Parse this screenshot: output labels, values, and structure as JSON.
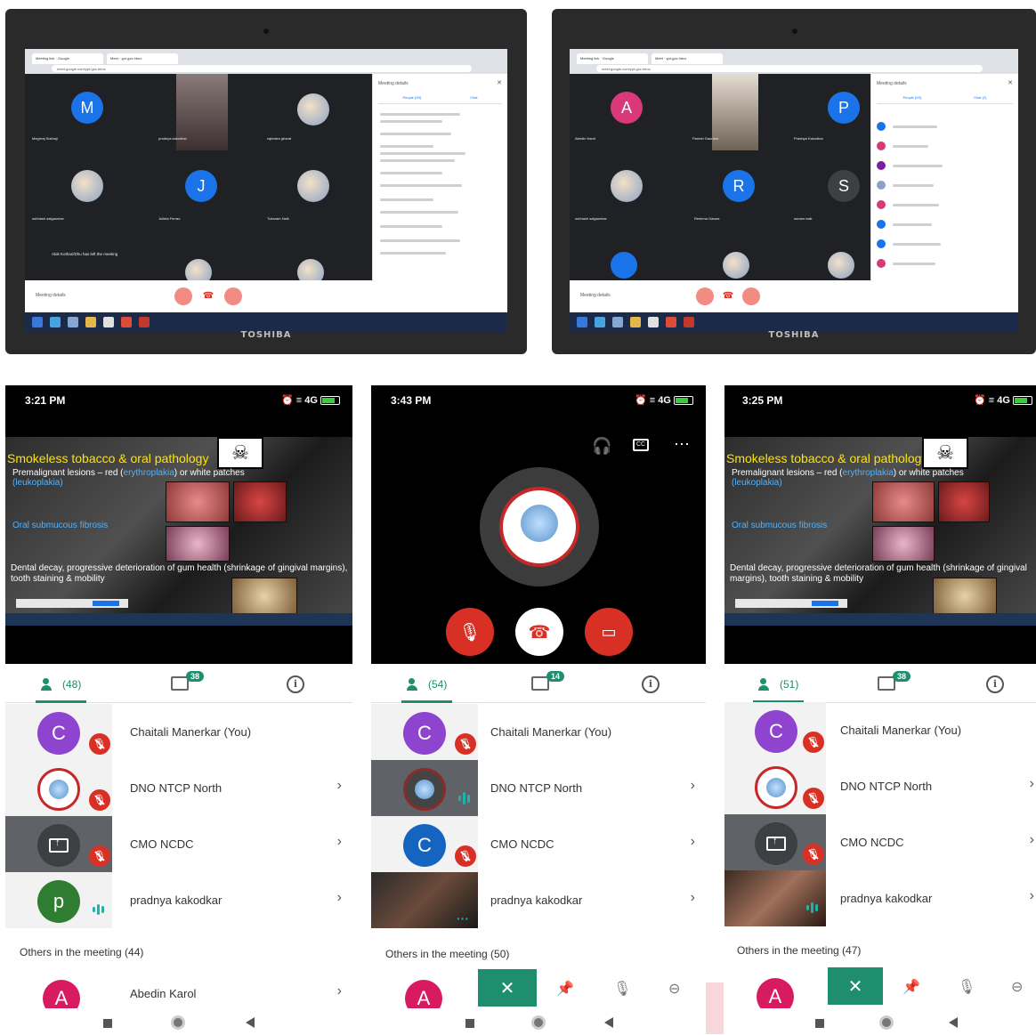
{
  "colors": {
    "meet_green": "#1e8e6e",
    "end_red": "#d93025",
    "slide_yellow": "#ffe400",
    "slide_blue": "#4fb3ff"
  },
  "laptops": [
    {
      "brand": "TOSHIBA",
      "meeting_details": "Meeting details",
      "panel_title": "Meeting details",
      "tabs": [
        "People (53)",
        "Chat"
      ],
      "tiles": [
        {
          "initial": "M",
          "name": "Meghraj Sukhaji",
          "color": "#1a73e8"
        },
        {
          "initial": "",
          "name": "pradnya kakodkar",
          "photo": true
        },
        {
          "initial": "",
          "name": "rajendra gharat",
          "photo": true
        },
        {
          "initial": "",
          "name": "subhash salgaonkar",
          "photo": true
        },
        {
          "initial": "J",
          "name": "Julieta Ferrao",
          "color": "#1a73e8"
        },
        {
          "initial": "",
          "name": "Tukaram Naik",
          "photo": true
        }
      ],
      "left_msg": "Alok Kothari/Dhu has left the meeting"
    },
    {
      "brand": "TOSHIBA",
      "meeting_details": "Meeting details",
      "panel_title": "Meeting details",
      "tabs": [
        "People (53)",
        "Chat (2)"
      ],
      "tiles": [
        {
          "initial": "A",
          "name": "Abedin Karol",
          "color": "#d93879"
        },
        {
          "initial": "",
          "name": "Paresh Gaonkar",
          "photo": true
        },
        {
          "initial": "P",
          "name": "Pradnya Kakodkar",
          "color": "#1a73e8"
        },
        {
          "initial": "",
          "name": "subhash salgaonkar",
          "photo": true
        },
        {
          "initial": "R",
          "name": "Reshma Gawas",
          "color": "#1a73e8"
        },
        {
          "initial": "S",
          "name": "sonam naik",
          "color": "#3c4043"
        }
      ]
    }
  ],
  "phones": [
    {
      "time": "3:21 PM",
      "network": "4G",
      "slide": {
        "title": "Smokeless tobacco & oral pathology",
        "line1": "Premalignant lesions – red (",
        "line1_hl": "erythroplakia",
        "line1_end": ") or white patches",
        "line2": "(leukoplakia)",
        "line3": "Oral submucous fibrosis",
        "line4": "Dental decay, progressive deterioration of gum health (shrinkage of gingival margins), tooth staining & mobility"
      },
      "people_count": "(48)",
      "chat_count": "38",
      "participants": [
        {
          "name": "Chaitali Manerkar (You)",
          "type": "avatar",
          "initial": "C",
          "color": "#8e44ce",
          "status": "muted"
        },
        {
          "name": "DNO NTCP North",
          "type": "logo",
          "status": "muted"
        },
        {
          "name": "CMO NCDC",
          "type": "screen",
          "status": "muted"
        },
        {
          "name": "pradnya kakodkar",
          "type": "avatar",
          "initial": "p",
          "color": "#2e7d32",
          "status": "speaking"
        }
      ],
      "others": "Others in the meeting (44)",
      "next": {
        "name": "Abedin Karol",
        "initial": "A",
        "color": "#d81b60"
      }
    },
    {
      "time": "3:43 PM",
      "network": "4G",
      "people_count": "(54)",
      "chat_count": "14",
      "participants": [
        {
          "name": "Chaitali Manerkar (You)",
          "type": "avatar",
          "initial": "C",
          "color": "#8e44ce",
          "status": "muted"
        },
        {
          "name": "DNO NTCP North",
          "type": "logo-dark",
          "status": "speaking"
        },
        {
          "name": "CMO NCDC",
          "type": "avatar",
          "initial": "C",
          "color": "#1565c0",
          "status": "muted"
        },
        {
          "name": "pradnya kakodkar",
          "type": "photo",
          "status": "dots"
        }
      ],
      "others": "Others in the meeting (50)",
      "next": {
        "name": "",
        "initial": "A",
        "color": "#d81b60"
      }
    },
    {
      "time": "3:25 PM",
      "network": "4G",
      "slide": {
        "title": "Smokeless tobacco & oral pathology",
        "line1": "Premalignant lesions – red (",
        "line1_hl": "erythroplakia",
        "line1_end": ") or white patches",
        "line2": "(leukoplakia)",
        "line3": "Oral submucous fibrosis",
        "line4": "Dental decay, progressive deterioration of gum health (shrinkage of gingival margins), tooth staining & mobility"
      },
      "people_count": "(51)",
      "chat_count": "38",
      "participants": [
        {
          "name": "Chaitali Manerkar (You)",
          "type": "avatar",
          "initial": "C",
          "color": "#8e44ce",
          "status": "muted"
        },
        {
          "name": "DNO NTCP North",
          "type": "logo",
          "status": "muted"
        },
        {
          "name": "CMO NCDC",
          "type": "screen",
          "status": "muted"
        },
        {
          "name": "pradnya kakodkar",
          "type": "photo",
          "status": "speaking"
        }
      ],
      "others": "Others in the meeting (47)",
      "next": {
        "name": "",
        "initial": "A",
        "color": "#d81b60"
      }
    }
  ]
}
